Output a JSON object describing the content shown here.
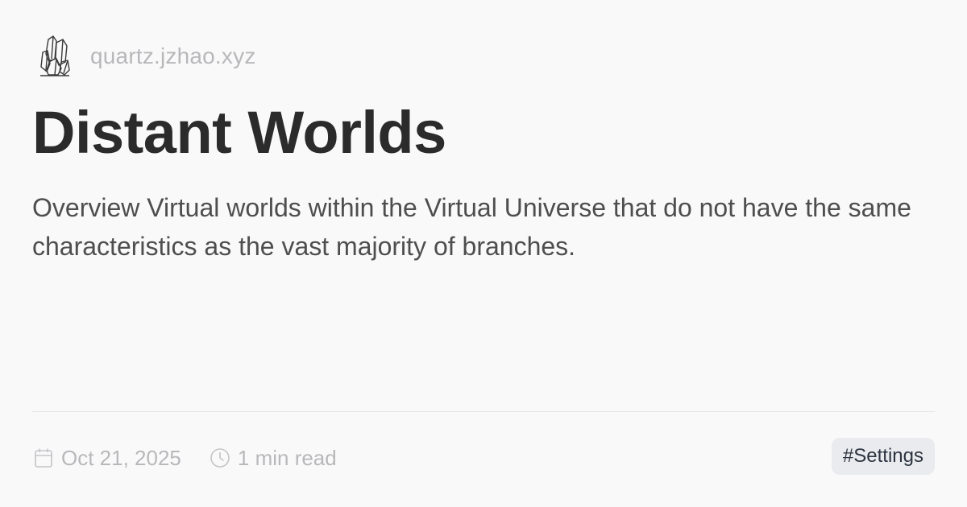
{
  "site": {
    "logo_icon": "crystal-icon",
    "name": "quartz.jzhao.xyz"
  },
  "article": {
    "title": "Distant Worlds",
    "description": "Overview Virtual worlds within the Virtual Universe that do not have the same characteristics as the vast majority of branches."
  },
  "meta": {
    "date_icon": "calendar-icon",
    "date": "Oct 21, 2025",
    "reading_icon": "clock-icon",
    "reading_time": "1 min read"
  },
  "tags": [
    "#Settings"
  ],
  "colors": {
    "background": "#faf9fa",
    "title": "#2b2b2b",
    "body_text": "#4e4e4e",
    "muted": "#b8b8bb",
    "tag_bg": "#e9ebee",
    "tag_text": "#2d3440"
  }
}
